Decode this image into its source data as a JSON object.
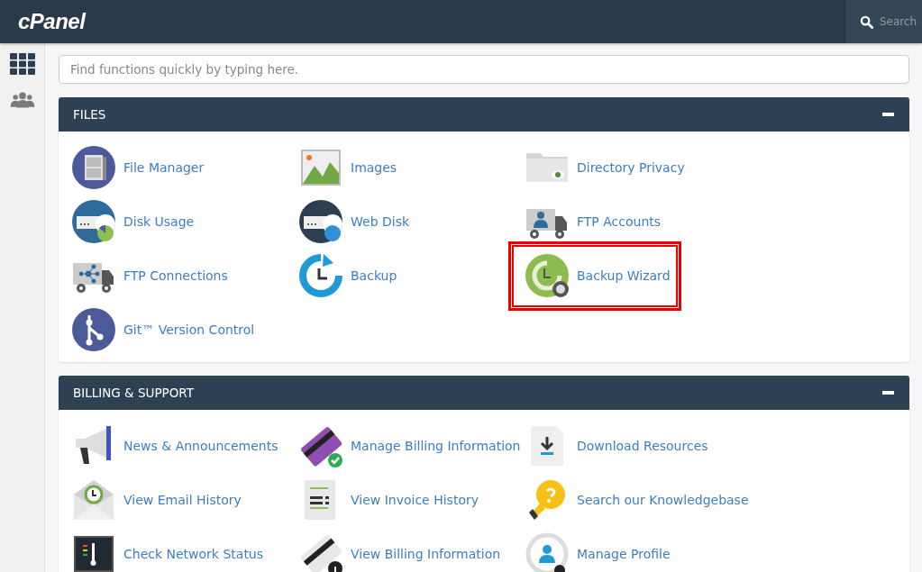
{
  "top_bar": {
    "logo": "cPanel",
    "search": {
      "placeholder": "Search"
    }
  },
  "sidebar": {
    "items": [
      {
        "selected": true
      },
      {
        "selected": false
      }
    ]
  },
  "find_field": {
    "placeholder": "Find functions quickly by typing here."
  },
  "sections": [
    {
      "title": "FILES",
      "expanded": true,
      "items": [
        {
          "label": "File Manager",
          "highlighted": false
        },
        {
          "label": "Images",
          "highlighted": false
        },
        {
          "label": "Directory Privacy",
          "highlighted": false
        },
        {
          "label": "Disk Usage",
          "highlighted": false
        },
        {
          "label": "Web Disk",
          "highlighted": false
        },
        {
          "label": "FTP Accounts",
          "highlighted": false
        },
        {
          "label": "FTP Connections",
          "highlighted": false
        },
        {
          "label": "Backup",
          "highlighted": false
        },
        {
          "label": "Backup Wizard",
          "highlighted": true
        },
        {
          "label": "Git™ Version Control",
          "highlighted": false
        }
      ]
    },
    {
      "title": "BILLING & SUPPORT",
      "expanded": true,
      "items": [
        {
          "label": "News & Announcements",
          "highlighted": false
        },
        {
          "label": "Manage Billing Information",
          "highlighted": false
        },
        {
          "label": "Download Resources",
          "highlighted": false
        },
        {
          "label": "View Email History",
          "highlighted": false
        },
        {
          "label": "View Invoice History",
          "highlighted": false
        },
        {
          "label": "Search our Knowledgebase",
          "highlighted": false
        },
        {
          "label": "Check Network Status",
          "highlighted": false
        },
        {
          "label": "View Billing Information",
          "highlighted": false
        },
        {
          "label": "Manage Profile",
          "highlighted": false
        }
      ]
    }
  ]
}
